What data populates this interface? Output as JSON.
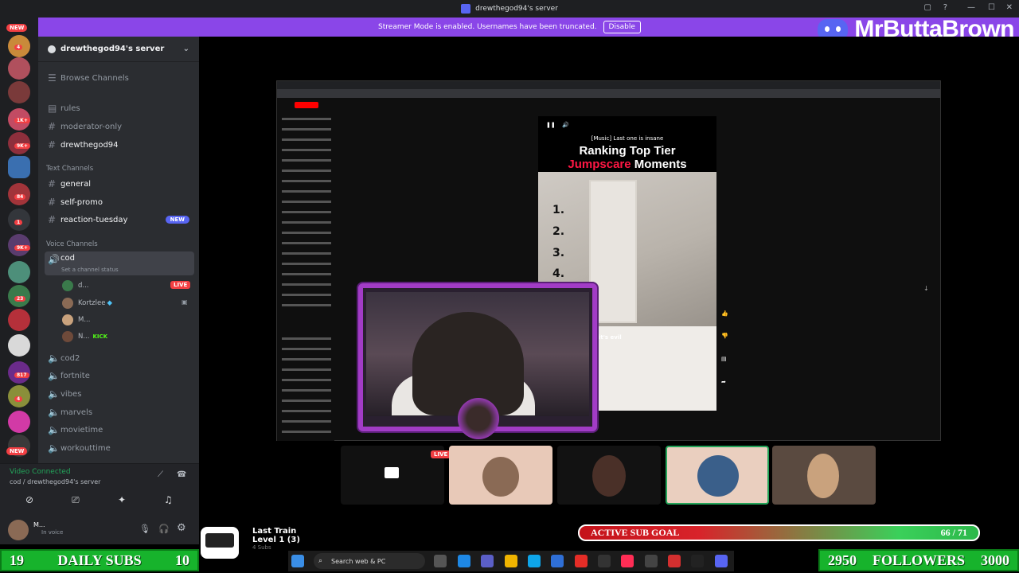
{
  "window": {
    "title": "drewthegod94's server"
  },
  "banner": {
    "text": "Streamer Mode is enabled. Usernames have been truncated.",
    "button": "Disable"
  },
  "brand": {
    "name": "MrButtaBrown"
  },
  "rail": {
    "new_top": "NEW",
    "new_bottom": "NEW",
    "badges": [
      "4",
      "1K+",
      "9K+",
      "84",
      "1",
      "9K+",
      "23",
      "817",
      "4"
    ]
  },
  "server": {
    "name": "drewthegod94's server"
  },
  "channels": {
    "browse": "Browse Channels",
    "top": [
      {
        "name": "rules"
      },
      {
        "name": "moderator-only"
      },
      {
        "name": "drewthegod94"
      }
    ],
    "text_category": "Text Channels",
    "text": [
      {
        "name": "general"
      },
      {
        "name": "self-promo"
      },
      {
        "name": "reaction-tuesday",
        "badge": "NEW"
      }
    ],
    "voice_category": "Voice Channels",
    "voice_active": {
      "name": "cod",
      "status": "Set a channel status"
    },
    "voice_users": [
      {
        "name": "d...",
        "badge": "LIVE"
      },
      {
        "name": "Kortzlee"
      },
      {
        "name": "M..."
      },
      {
        "name": "N...",
        "tag": "KICK"
      }
    ],
    "voice_other": [
      {
        "name": "cod2"
      },
      {
        "name": "fortnite"
      },
      {
        "name": "vibes"
      },
      {
        "name": "marvels"
      },
      {
        "name": "movietime"
      },
      {
        "name": "workouttime"
      }
    ]
  },
  "voice_panel": {
    "status": "Video Connected",
    "location": "cod / drewthegod94's server"
  },
  "user_panel": {
    "name": "M...",
    "status": "In voice"
  },
  "video": {
    "caption": "[Music] Last one is insane",
    "title_line1": "Ranking Top Tier",
    "title_red": "Jumpscare",
    "title_white": "Moments",
    "ranks": [
      "1.",
      "2.",
      "3.",
      "4."
    ],
    "subtitle": "it's evil"
  },
  "tiles": {
    "live": "LIVE"
  },
  "goal": {
    "label": "ACTIVE SUB GOAL",
    "current": "66",
    "target": "71",
    "display": "66 / 71",
    "progress": 0.93
  },
  "track": {
    "title": "Last Train",
    "level": "Level 1 (3)",
    "sub": "4 Subs"
  },
  "stats": {
    "daily_subs": {
      "label": "DAILY SUBS",
      "current": "19",
      "goal": "10"
    },
    "followers": {
      "label": "FOLLOWERS",
      "current": "2950",
      "goal": "3000"
    }
  },
  "taskbar": {
    "search_placeholder": "Search web & PC"
  },
  "colors": {
    "accent": "#8a46e8",
    "discord": "#5865f2",
    "live": "#f23f43",
    "goal_green": "#2cb84a"
  }
}
